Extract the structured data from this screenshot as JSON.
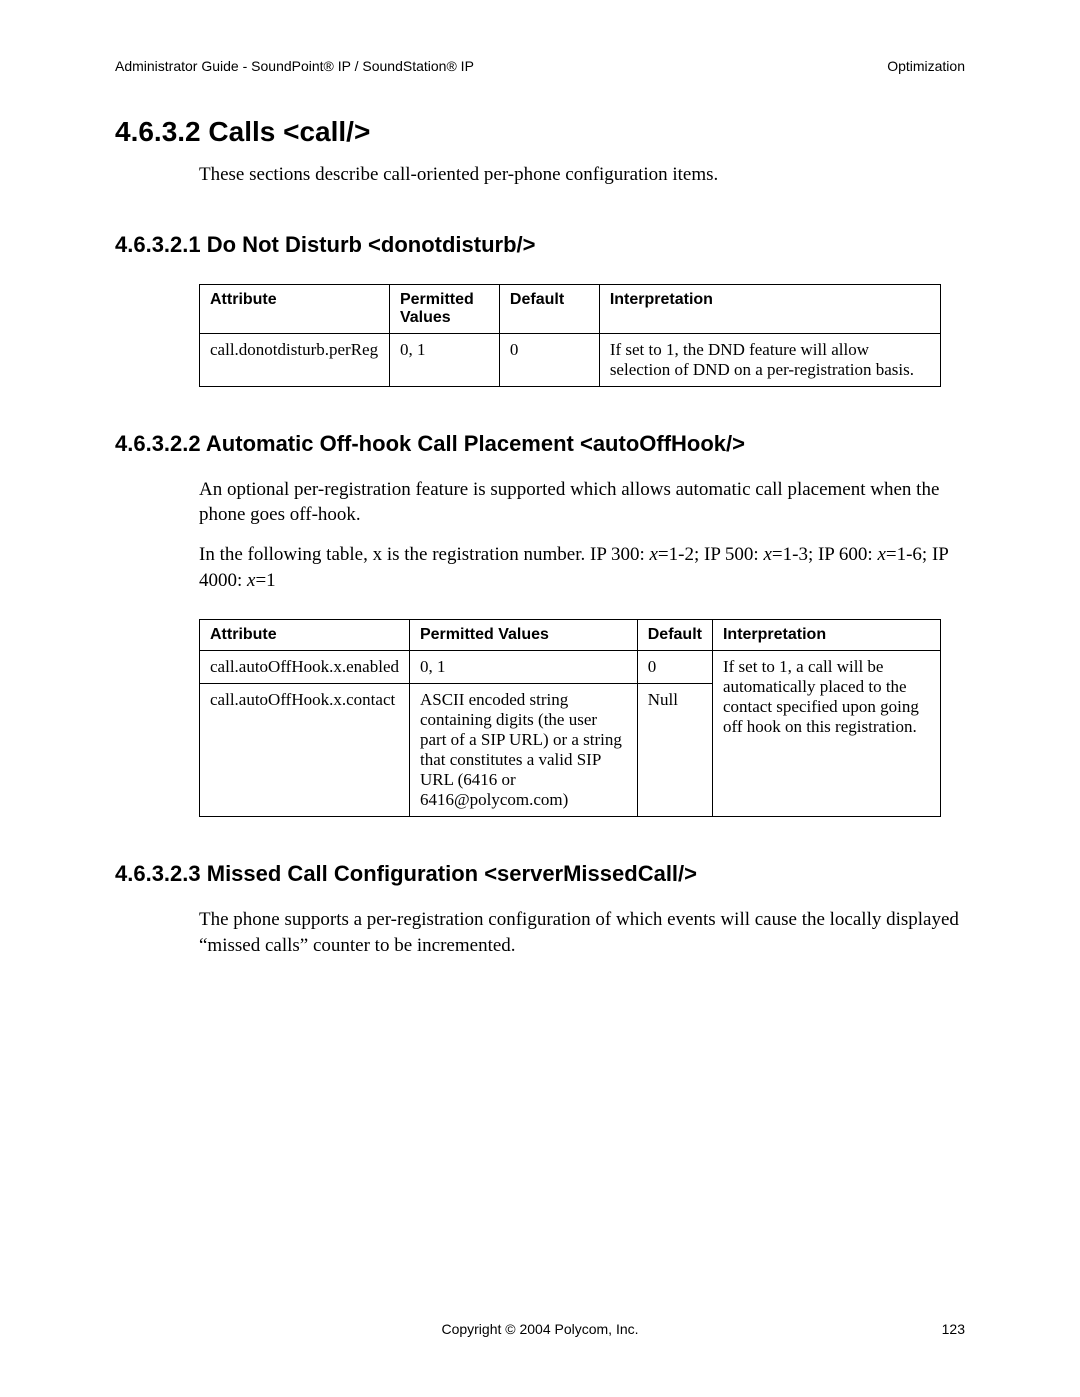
{
  "header": {
    "left": "Administrator Guide - SoundPoint® IP / SoundStation® IP",
    "right": "Optimization"
  },
  "section": {
    "title": "4.6.3.2  Calls <call/>",
    "intro": "These sections describe call-oriented per-phone configuration items."
  },
  "dnd": {
    "title": "4.6.3.2.1  Do Not Disturb <donotdisturb/>",
    "table": {
      "headers": {
        "attribute": "Attribute",
        "permitted": "Permitted Values",
        "default": "Default",
        "interpretation": "Interpretation"
      },
      "row": {
        "attribute": "call.donotdisturb.perReg",
        "permitted": "0, 1",
        "default": "0",
        "interpretation": "If set to 1, the DND feature will allow selection of DND on a per-registration basis."
      }
    }
  },
  "autoOffHook": {
    "title": "4.6.3.2.2  Automatic Off-hook Call Placement <autoOffHook/>",
    "para1": "An optional per-registration feature is supported which allows automatic call placement when the phone goes off-hook.",
    "para2_pre": "In the following table, x is the registration number.  IP 300: ",
    "para2_x1": "x",
    "para2_mid1": "=1-2; IP 500: ",
    "para2_x2": "x",
    "para2_mid2": "=1-3; IP 600: ",
    "para2_x3": "x",
    "para2_mid3": "=1-6; IP 4000: ",
    "para2_x4": "x",
    "para2_end": "=1",
    "table": {
      "headers": {
        "attribute": "Attribute",
        "permitted": "Permitted Values",
        "default": "Default",
        "interpretation": "Interpretation"
      },
      "row1": {
        "attribute": "call.autoOffHook.x.enabled",
        "permitted": "0, 1",
        "default": "0"
      },
      "row2": {
        "attribute": "call.autoOffHook.x.contact",
        "permitted": "ASCII encoded string containing digits (the user part of a SIP URL) or a string that constitutes a valid SIP URL  (6416 or 6416@polycom.com)",
        "default": "Null"
      },
      "interpretation": "If set to 1, a call will be automatically placed to the contact specified upon going off hook on this registration."
    }
  },
  "missedCall": {
    "title": "4.6.3.2.3  Missed Call Configuration <serverMissedCall/>",
    "para": "The phone supports a per-registration configuration of which events will cause the locally displayed “missed calls” counter to be incremented."
  },
  "footer": {
    "copyright": "Copyright © 2004 Polycom, Inc.",
    "page": "123"
  }
}
